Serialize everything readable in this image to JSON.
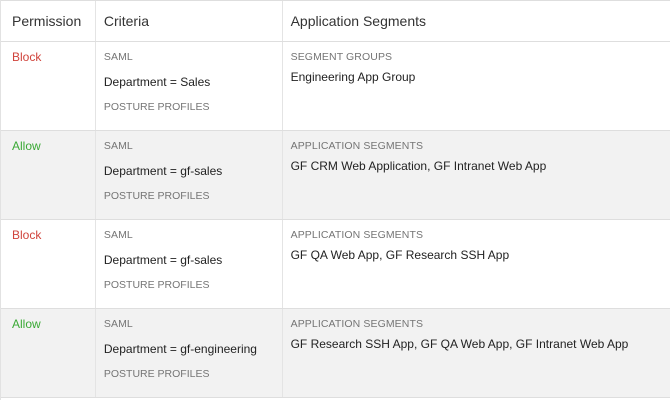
{
  "table": {
    "headers": {
      "permission": "Permission",
      "criteria": "Criteria",
      "segments": "Application Segments"
    },
    "rows": [
      {
        "permission": "Block",
        "criteria_type": "SAML",
        "criteria_value": "Department = Sales",
        "posture": "POSTURE PROFILES",
        "segment_type": "SEGMENT GROUPS",
        "segment_value": "Engineering App Group"
      },
      {
        "permission": "Allow",
        "criteria_type": "SAML",
        "criteria_value": "Department = gf-sales",
        "posture": "POSTURE PROFILES",
        "segment_type": "APPLICATION SEGMENTS",
        "segment_value": "GF CRM Web Application, GF Intranet Web App"
      },
      {
        "permission": "Block",
        "criteria_type": "SAML",
        "criteria_value": "Department = gf-sales",
        "posture": "POSTURE PROFILES",
        "segment_type": "APPLICATION SEGMENTS",
        "segment_value": "GF QA Web App, GF Research SSH App"
      },
      {
        "permission": "Allow",
        "criteria_type": "SAML",
        "criteria_value": "Department = gf-engineering",
        "posture": "POSTURE PROFILES",
        "segment_type": "APPLICATION SEGMENTS",
        "segment_value": "GF Research SSH App, GF QA Web App, GF Intranet Web App"
      }
    ]
  },
  "colors": {
    "block": "#d0433b",
    "allow": "#3aa935",
    "row_shade": "#f2f2f2"
  }
}
